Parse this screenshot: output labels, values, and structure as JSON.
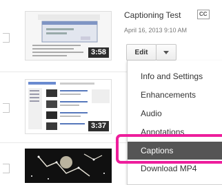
{
  "videos": [
    {
      "duration": "3:58",
      "title": "Captioning Test",
      "badge": "CC",
      "date": "April 16, 2013 9:10 AM",
      "edit_label": "Edit"
    },
    {
      "duration": "3:37"
    },
    {
      "duration": ""
    }
  ],
  "menu": {
    "items": [
      {
        "label": "Info and Settings",
        "active": false
      },
      {
        "label": "Enhancements",
        "active": false
      },
      {
        "label": "Audio",
        "active": false
      },
      {
        "label": "Annotations",
        "active": false
      },
      {
        "label": "Captions",
        "active": true
      },
      {
        "label": "Download MP4",
        "active": false
      }
    ]
  },
  "colors": {
    "highlight": "#ee1e9c",
    "active_item": "#555555"
  },
  "icons": {
    "edit_dropdown": "chevron-down-icon"
  }
}
